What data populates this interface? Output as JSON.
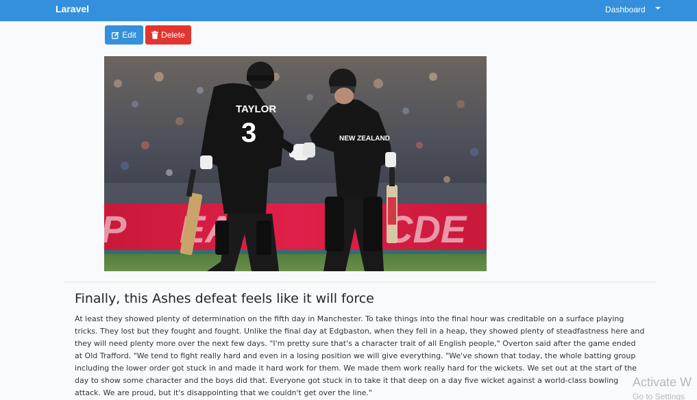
{
  "navbar": {
    "brand": "Laravel",
    "user_menu": "Dashboard",
    "color": "#3490dc"
  },
  "actions": {
    "edit_label": "Edit",
    "delete_label": "Delete",
    "edit_color": "#3490dc",
    "delete_color": "#e3342f"
  },
  "post": {
    "title": "Finally, this Ashes defeat feels like it will force",
    "body": "At least they showed plenty of determination on the fifth day in Manchester. To take things into the final hour was creditable on a surface playing tricks. They lost but they fought and fought. Unlike the final day at Edgbaston, when they fell in a heap, they showed plenty of steadfastness here and they will need plenty more over the next few days. \"I'm pretty sure that's a character trait of all English people,\" Overton said after the game ended at Old Trafford. \"We tend to fight really hard and even in a losing position we will give everything. \"We've shown that today, the whole batting group including the lower order got stuck in and made it hard work for them. We made them work really hard for the wickets. We set out at the start of the day to show some character and the boys did that. Everyone got stuck in to take it that deep on a day five wicket against a world-class bowling attack. We are proud, but it's disappointing that we couldn't get over the line.\"",
    "image": {
      "player1_name": "TAYLOR",
      "player1_number": "3",
      "player2_shirt": "NEW ZEALAND"
    }
  },
  "watermark": {
    "line1": "Activate W",
    "line2": "Go to Settings"
  }
}
